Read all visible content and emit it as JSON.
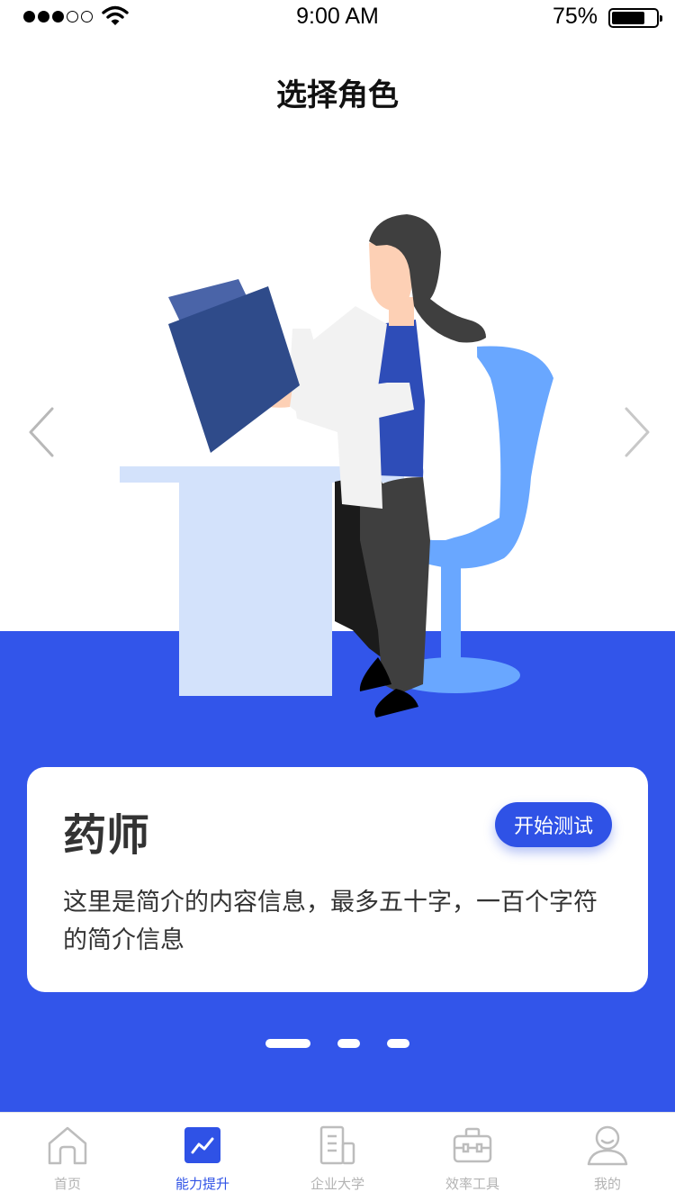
{
  "status_bar": {
    "time": "9:00 AM",
    "battery_percent": "75%",
    "battery_level": 0.75,
    "signal_bars_filled": 3,
    "signal_bars_total": 5
  },
  "header": {
    "title": "选择角色"
  },
  "carousel": {
    "prev_icon": "chevron-left-icon",
    "next_icon": "chevron-right-icon",
    "active_index": 0,
    "total": 3
  },
  "role_card": {
    "title": "药师",
    "button_label": "开始测试",
    "description": "这里是简介的内容信息，最多五十字，一百个字符的简介信息"
  },
  "tab_bar": {
    "items": [
      {
        "label": "首页",
        "icon": "home-icon",
        "active": false
      },
      {
        "label": "能力提升",
        "icon": "chart-trend-icon",
        "active": true
      },
      {
        "label": "企业大学",
        "icon": "building-icon",
        "active": false
      },
      {
        "label": "效率工具",
        "icon": "toolbox-icon",
        "active": false
      },
      {
        "label": "我的",
        "icon": "user-icon",
        "active": false
      }
    ]
  },
  "colors": {
    "primary": "#3255ea",
    "button": "#2f52e6",
    "tab_inactive": "#b3b3b3",
    "background": "#ffffff"
  }
}
